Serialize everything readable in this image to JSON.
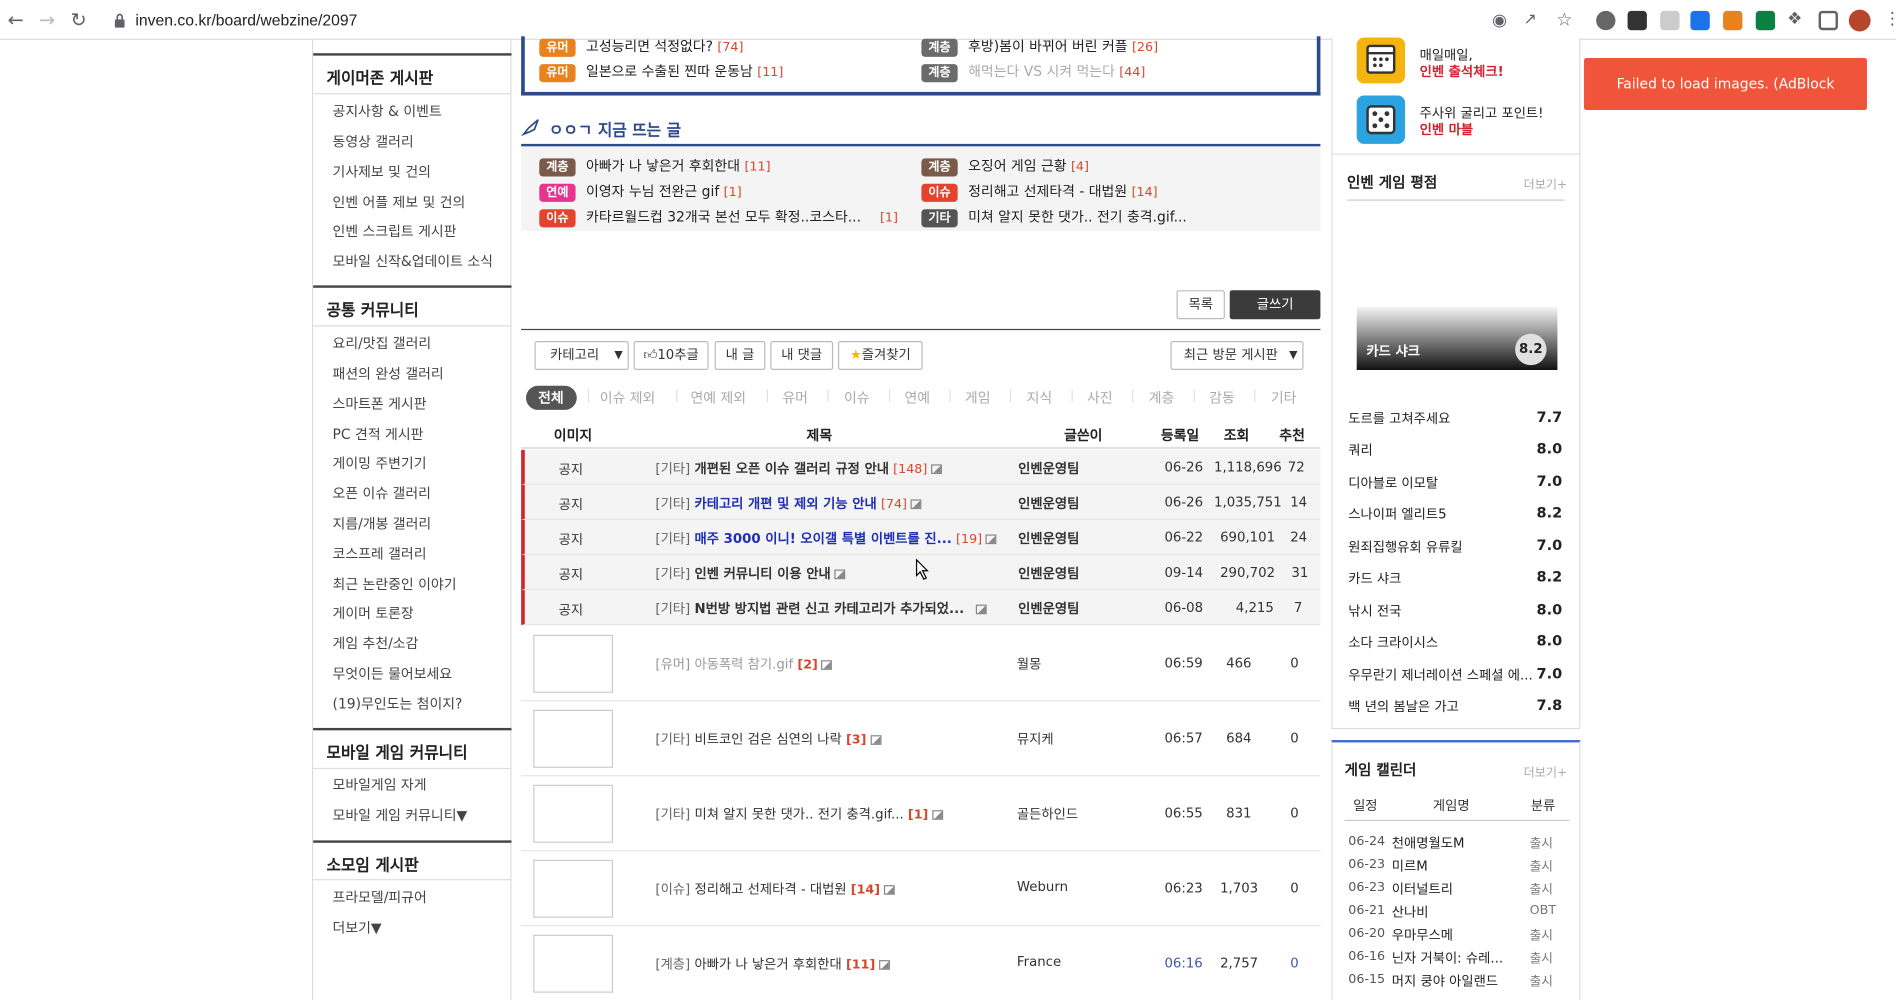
{
  "browser": {
    "url": "inven.co.kr/board/webzine/2097"
  },
  "toast": {
    "text": "Failed to load images. (AdBlock Exception)"
  },
  "sidebar": {
    "sections": [
      {
        "title": "게이머존 게시판",
        "items": [
          "공지사항 & 이벤트",
          "동영상 갤러리",
          "기사제보 및 건의",
          "인벤 어플 제보 및 건의",
          "인벤 스크립트 게시판",
          "모바일 신작&업데이트 소식"
        ]
      },
      {
        "title": "공통 커뮤니티",
        "items": [
          "요리/맛집 갤러리",
          "패션의 완성 갤러리",
          "스마트폰 게시판",
          "PC 견적 게시판",
          "게이밍 주변기기",
          "오픈 이슈 갤러리",
          "지름/개봉 갤러리",
          "코스프레 갤러리",
          "최근 논란중인 이야기",
          "게이머 토론장",
          "게임 추천/소감",
          "무엇이든 물어보세요",
          "(19)무인도는 첨이지?"
        ]
      },
      {
        "title": "모바일 게임 커뮤니티",
        "items": [
          "모바일게임 자게",
          "모바일 게임 커뮤니티▼"
        ]
      },
      {
        "title": "소모임 게시판",
        "items": [
          "프라모델/피규어",
          "더보기▼"
        ]
      }
    ]
  },
  "top_box": {
    "left": [
      {
        "tag": "유머",
        "title": "고성능리면 석정없다?",
        "count": "[74]"
      },
      {
        "tag": "유머",
        "title": "일본으로 수출된 찐따 운동남",
        "count": "[11]"
      }
    ],
    "right": [
      {
        "tag": "계층",
        "title": "후방)봄이 바뀌어 버린 커플",
        "count": "[26]"
      },
      {
        "tag": "계층",
        "title": "해먹는다 VS 시켜 먹는다",
        "count": "[44]"
      }
    ]
  },
  "hot": {
    "title": "ㅇㅇㄱ 지금 뜨는 글",
    "left": [
      {
        "tag": "계층",
        "title": "아빠가 나 낳은거 후회한대",
        "count": "[11]"
      },
      {
        "tag": "연예",
        "title": "이영자 누님 전완근 gif",
        "count": "[1]"
      },
      {
        "tag": "이슈",
        "title": "카타르월드컵 32개국 본선 모두 확정..코스타...",
        "count": "[1]"
      }
    ],
    "right": [
      {
        "tag": "계층",
        "title": "오징어 게임 근황",
        "count": "[4]"
      },
      {
        "tag": "이슈",
        "title": "정리해고 선제타격 - 대법원",
        "count": "[14]"
      },
      {
        "tag": "기타",
        "title": "미쳐 알지 못한 댓가.. 전기 충격.gif...",
        "count": ""
      }
    ]
  },
  "buttons": {
    "list": "목록",
    "write": "글쓰기",
    "category": "카테고리",
    "like10": "10추글",
    "mypost": "내 글",
    "mycomment": "내 댓글",
    "favorite": "즐겨찾기",
    "recent": "최근 방문 게시판"
  },
  "categories": [
    "전체",
    "이슈 제외",
    "연예 제외",
    "유머",
    "이슈",
    "연예",
    "게임",
    "지식",
    "사진",
    "계층",
    "감동",
    "기타"
  ],
  "table": {
    "headers": {
      "image": "이미지",
      "title": "제목",
      "author": "글쓴이",
      "date": "등록일",
      "views": "조회",
      "recommend": "추천"
    },
    "notices": [
      {
        "label": "공지",
        "cat": "[기타]",
        "title": "개편된 오픈 이슈 갤러리 규정 안내",
        "count": "[148]",
        "author": "인벤운영팀",
        "date": "06-26",
        "views": "1,118,696",
        "rec": "72",
        "blue": false
      },
      {
        "label": "공지",
        "cat": "[기타]",
        "title": "카테고리 개편 및 제외 기능 안내",
        "count": "[74]",
        "author": "인벤운영팀",
        "date": "06-26",
        "views": "1,035,751",
        "rec": "14",
        "blue": true
      },
      {
        "label": "공지",
        "cat": "[기타]",
        "title": "매주 3000 이니! 오이갤 특별 이벤트를 진...",
        "count": "[19]",
        "author": "인벤운영팀",
        "date": "06-22",
        "views": "690,101",
        "rec": "24",
        "blue": true
      },
      {
        "label": "공지",
        "cat": "[기타]",
        "title": "인벤 커뮤니티 이용 안내",
        "count": "",
        "author": "인벤운영팀",
        "date": "09-14",
        "views": "290,702",
        "rec": "31",
        "blue": false
      },
      {
        "label": "공지",
        "cat": "[기타]",
        "title": "N번방 방지법 관련 신고 카테고리가 추가되었...",
        "count": "",
        "author": "인벤운영팀",
        "date": "06-08",
        "views": "4,215",
        "rec": "7",
        "blue": false
      }
    ],
    "posts": [
      {
        "cat": "[유머]",
        "title": "아동폭력 참기.gif",
        "count": "[2]",
        "author": "월몽",
        "time": "06:59",
        "views": "466",
        "rec": "0",
        "faded": true
      },
      {
        "cat": "[기타]",
        "title": "비트코인 검은 심연의 나락",
        "count": "[3]",
        "author": "뮤지케",
        "time": "06:57",
        "views": "684",
        "rec": "0",
        "faded": false
      },
      {
        "cat": "[기타]",
        "title": "미쳐 알지 못한 댓가.. 전기 충격.gif...",
        "count": "[1]",
        "author": "골든하인드",
        "time": "06:55",
        "views": "831",
        "rec": "0",
        "faded": false
      },
      {
        "cat": "[이슈]",
        "title": "정리해고 선제타격 - 대법원",
        "count": "[14]",
        "author": "Weburn",
        "time": "06:23",
        "views": "1,703",
        "rec": "0",
        "faded": false
      },
      {
        "cat": "[계층]",
        "title": "아빠가 나 낳은거 후회한대",
        "count": "[11]",
        "author": "France",
        "time": "06:16",
        "views": "2,757",
        "rec": "0",
        "faded": false
      }
    ]
  },
  "right": {
    "promo": [
      {
        "line1": "매일매일,",
        "line2": "인벤 출석체크!"
      },
      {
        "line1": "주사위 굴리고 포인트!",
        "line2": "인벤 마블"
      }
    ],
    "rating": {
      "title": "인벤 게임 평점",
      "more": "더보기+",
      "featured": {
        "name": "카드 샤크",
        "score": "8.2"
      },
      "items": [
        {
          "name": "도르를 고쳐주세요",
          "score": "7.7"
        },
        {
          "name": "쿼리",
          "score": "8.0"
        },
        {
          "name": "디아블로 이모탈",
          "score": "7.0"
        },
        {
          "name": "스나이퍼 엘리트5",
          "score": "8.2"
        },
        {
          "name": "원죄집행유회 유류킬",
          "score": "7.0"
        },
        {
          "name": "카드 샤크",
          "score": "8.2"
        },
        {
          "name": "낚시 전국",
          "score": "8.0"
        },
        {
          "name": "소다 크라이시스",
          "score": "8.0"
        },
        {
          "name": "우무란기 제너레이션 스페셜 에...",
          "score": "7.0"
        },
        {
          "name": "백 년의 봄날은 가고",
          "score": "7.8"
        }
      ]
    },
    "calendar": {
      "title": "게임 캘린더",
      "more": "더보기+",
      "headers": {
        "date": "일정",
        "name": "게임명",
        "type": "분류"
      },
      "items": [
        {
          "date": "06-24",
          "name": "천애명월도M",
          "type": "출시"
        },
        {
          "date": "06-23",
          "name": "미르M",
          "type": "출시"
        },
        {
          "date": "06-23",
          "name": "이터널트리",
          "type": "출시"
        },
        {
          "date": "06-21",
          "name": "산나비",
          "type": "OBT"
        },
        {
          "date": "06-20",
          "name": "우마무스메",
          "type": "출시"
        },
        {
          "date": "06-16",
          "name": "닌자 거북이: 슈레...",
          "type": "출시"
        },
        {
          "date": "06-15",
          "name": "머지 쿵야 아일랜드",
          "type": "출시"
        }
      ]
    }
  }
}
